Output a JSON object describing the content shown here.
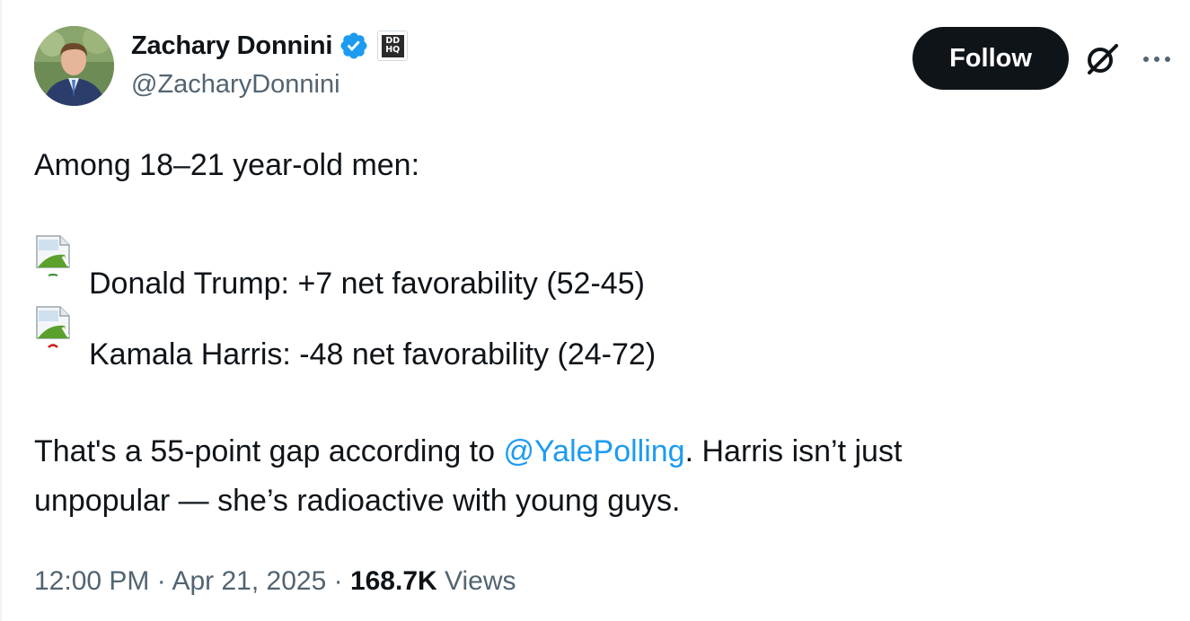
{
  "author": {
    "display_name": "Zachary Donnini",
    "handle": "@ZacharyDonnini",
    "verified": true,
    "affiliate_badge_text": [
      "DD",
      "HQ"
    ]
  },
  "header": {
    "follow_label": "Follow"
  },
  "tweet": {
    "intro": "Among 18–21 year-old men:",
    "items": [
      {
        "label": "Donald Trump: +7 net favorability (52-45)",
        "emoji_color": "#2e8b2e"
      },
      {
        "label": "Kamala Harris: -48 net favorability (24-72)",
        "emoji_color": "#d02020"
      }
    ],
    "gap_prefix": "That's a 55-point gap according to ",
    "gap_mention": "@YalePolling",
    "gap_suffix": ". Harris isn’t just",
    "gap_line_2": "unpopular — she’s radioactive with young guys."
  },
  "footer": {
    "time": "12:00 PM",
    "date": "Apr 21, 2025",
    "views_count": "168.7K",
    "views_label": "Views",
    "separator": "·"
  },
  "colors": {
    "text": "#0f1419",
    "secondary": "#536471",
    "link": "#1d9bf0",
    "verified": "#1d9bf0",
    "button": "#0f1419"
  },
  "icons": [
    "verified-badge-icon",
    "affiliate-badge-icon",
    "grok-icon",
    "more-options-icon",
    "broken-image-icon"
  ]
}
